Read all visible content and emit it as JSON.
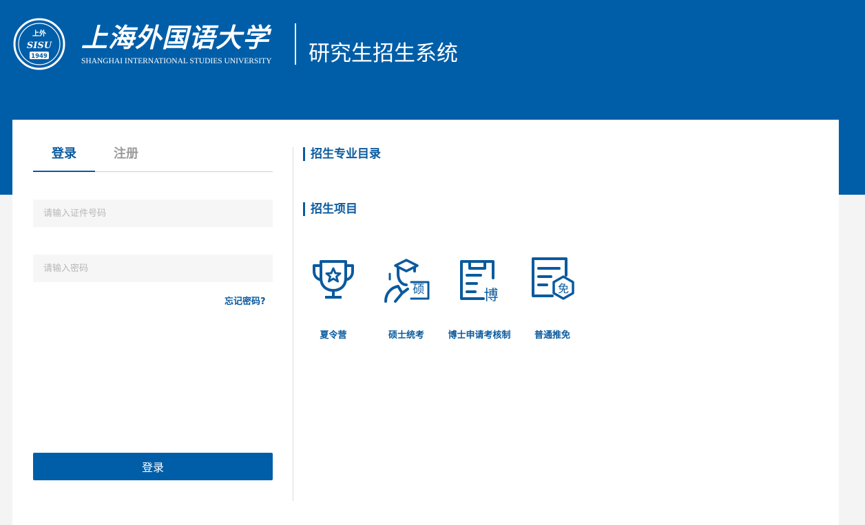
{
  "header": {
    "university_name_cn": "上海外国语大学",
    "university_name_en": "SHANGHAI INTERNATIONAL STUDIES UNIVERSITY",
    "seal": {
      "top_text": "上外",
      "monogram": "SISU",
      "year": "1949"
    },
    "system_title": "研究生招生系统"
  },
  "tabs": [
    {
      "label": "登录",
      "active": true
    },
    {
      "label": "注册",
      "active": false
    }
  ],
  "form": {
    "id_placeholder": "请输入证件号码",
    "id_value": "",
    "password_placeholder": "请输入密码",
    "password_value": "",
    "forgot_label": "忘记密码?",
    "submit_label": "登录"
  },
  "sections": {
    "catalog_title": "招生专业目录",
    "projects_title": "招生项目"
  },
  "projects": [
    {
      "label": "夏令营",
      "icon": "trophy-icon"
    },
    {
      "label": "硕士统考",
      "icon": "master-graduate-icon"
    },
    {
      "label": "博士申请考核制",
      "icon": "doctoral-clipboard-icon"
    },
    {
      "label": "普通推免",
      "icon": "exemption-document-icon"
    }
  ],
  "colors": {
    "brand_blue": "#005ea8",
    "link_blue": "#0a5a9e",
    "page_background": "#f4f4f5",
    "input_background": "#f6f6f6"
  }
}
